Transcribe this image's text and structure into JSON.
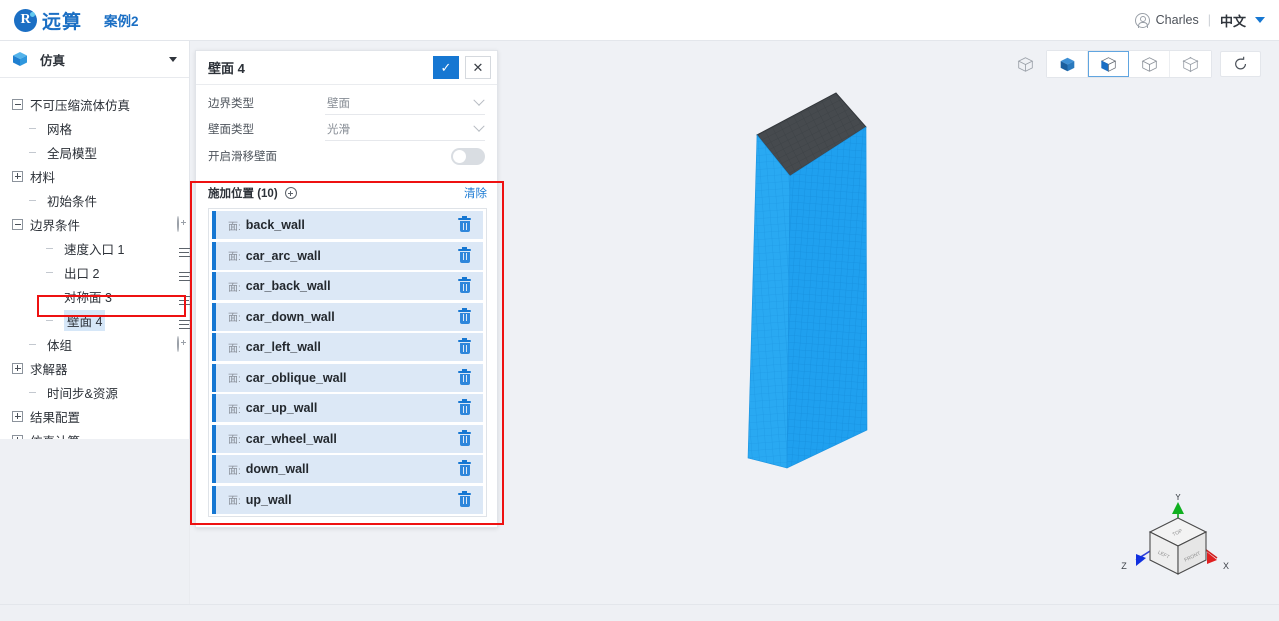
{
  "topbar": {
    "brand_glyph": "R",
    "brand_name": "远算",
    "case_name": "案例2",
    "user_name": "Charles",
    "divider": "|",
    "language": "中文",
    "avatar_icon": "user-circle-icon",
    "caret_icon": "caret-down-icon"
  },
  "sidebar": {
    "header_label": "仿真",
    "header_icon": "cube-icon",
    "tree": [
      {
        "label": "不可压缩流体仿真",
        "toggle": "minus",
        "indent": 0,
        "right_icon": "info",
        "selected": false
      },
      {
        "label": "网格",
        "toggle": "stub",
        "indent": 1,
        "right_icon": "none",
        "selected": false
      },
      {
        "label": "全局模型",
        "toggle": "stub",
        "indent": 1,
        "right_icon": "none",
        "selected": false
      },
      {
        "label": "材料",
        "toggle": "plus",
        "indent": 0,
        "right_icon": "none",
        "selected": false
      },
      {
        "label": "初始条件",
        "toggle": "stub",
        "indent": 1,
        "right_icon": "none",
        "selected": false
      },
      {
        "label": "边界条件",
        "toggle": "minus",
        "indent": 0,
        "right_icon": "plus",
        "selected": false
      },
      {
        "label": "速度入口 1",
        "toggle": "stub",
        "indent": 2,
        "right_icon": "list",
        "selected": false
      },
      {
        "label": "出口 2",
        "toggle": "stub",
        "indent": 2,
        "right_icon": "list",
        "selected": false
      },
      {
        "label": "对称面 3",
        "toggle": "stub",
        "indent": 2,
        "right_icon": "list",
        "selected": false
      },
      {
        "label": "壁面 4",
        "toggle": "stub",
        "indent": 2,
        "right_icon": "list",
        "selected": true
      },
      {
        "label": "体组",
        "toggle": "stub",
        "indent": 1,
        "right_icon": "plus",
        "selected": false
      },
      {
        "label": "求解器",
        "toggle": "plus",
        "indent": 0,
        "right_icon": "none",
        "selected": false
      },
      {
        "label": "时间步&资源",
        "toggle": "stub",
        "indent": 1,
        "right_icon": "none",
        "selected": false
      },
      {
        "label": "结果配置",
        "toggle": "plus",
        "indent": 0,
        "right_icon": "none",
        "selected": false
      },
      {
        "label": "仿真计算",
        "toggle": "plus",
        "indent": 0,
        "right_icon": "none",
        "selected": false
      }
    ]
  },
  "panel": {
    "title": "壁面 4",
    "confirm_label": "✓",
    "cancel_label": "✕",
    "fields": [
      {
        "label": "边界类型",
        "value": "壁面",
        "type": "select"
      },
      {
        "label": "壁面类型",
        "value": "光滑",
        "type": "select"
      }
    ],
    "switch": {
      "label": "开启滑移壁面",
      "on": false
    },
    "locations": {
      "title": "施加位置 (10)",
      "add_icon": "plus-circle-icon",
      "clear_label": "清除",
      "items": [
        {
          "prefix": "面:",
          "name": "back_wall"
        },
        {
          "prefix": "面:",
          "name": "car_arc_wall"
        },
        {
          "prefix": "面:",
          "name": "car_back_wall"
        },
        {
          "prefix": "面:",
          "name": "car_down_wall"
        },
        {
          "prefix": "面:",
          "name": "car_left_wall"
        },
        {
          "prefix": "面:",
          "name": "car_oblique_wall"
        },
        {
          "prefix": "面:",
          "name": "car_up_wall"
        },
        {
          "prefix": "面:",
          "name": "car_wheel_wall"
        },
        {
          "prefix": "面:",
          "name": "down_wall"
        },
        {
          "prefix": "面:",
          "name": "up_wall"
        }
      ]
    }
  },
  "viewport": {
    "toolbar": [
      {
        "name": "cube-outline-standalone-icon",
        "active": false
      },
      {
        "name": "cube-solid-icon",
        "active": false
      },
      {
        "name": "cube-half-solid-icon",
        "active": true
      },
      {
        "name": "cube-wireframe-icon",
        "active": false
      },
      {
        "name": "cube-points-icon",
        "active": false
      },
      {
        "name": "reset-view-icon",
        "active": false
      }
    ],
    "navcube": {
      "axis_x": "X",
      "axis_y": "Y",
      "axis_z": "Z",
      "color_x": "#e02020",
      "color_y": "#10b020",
      "color_z": "#1030e0"
    },
    "model": {
      "mesh_color": "#29a9f2",
      "top_face_color": "#464a4e",
      "background": "#eff1f5"
    }
  },
  "annotations": {
    "accent_red": "#ee1111",
    "accent_blue": "#1677d2"
  }
}
